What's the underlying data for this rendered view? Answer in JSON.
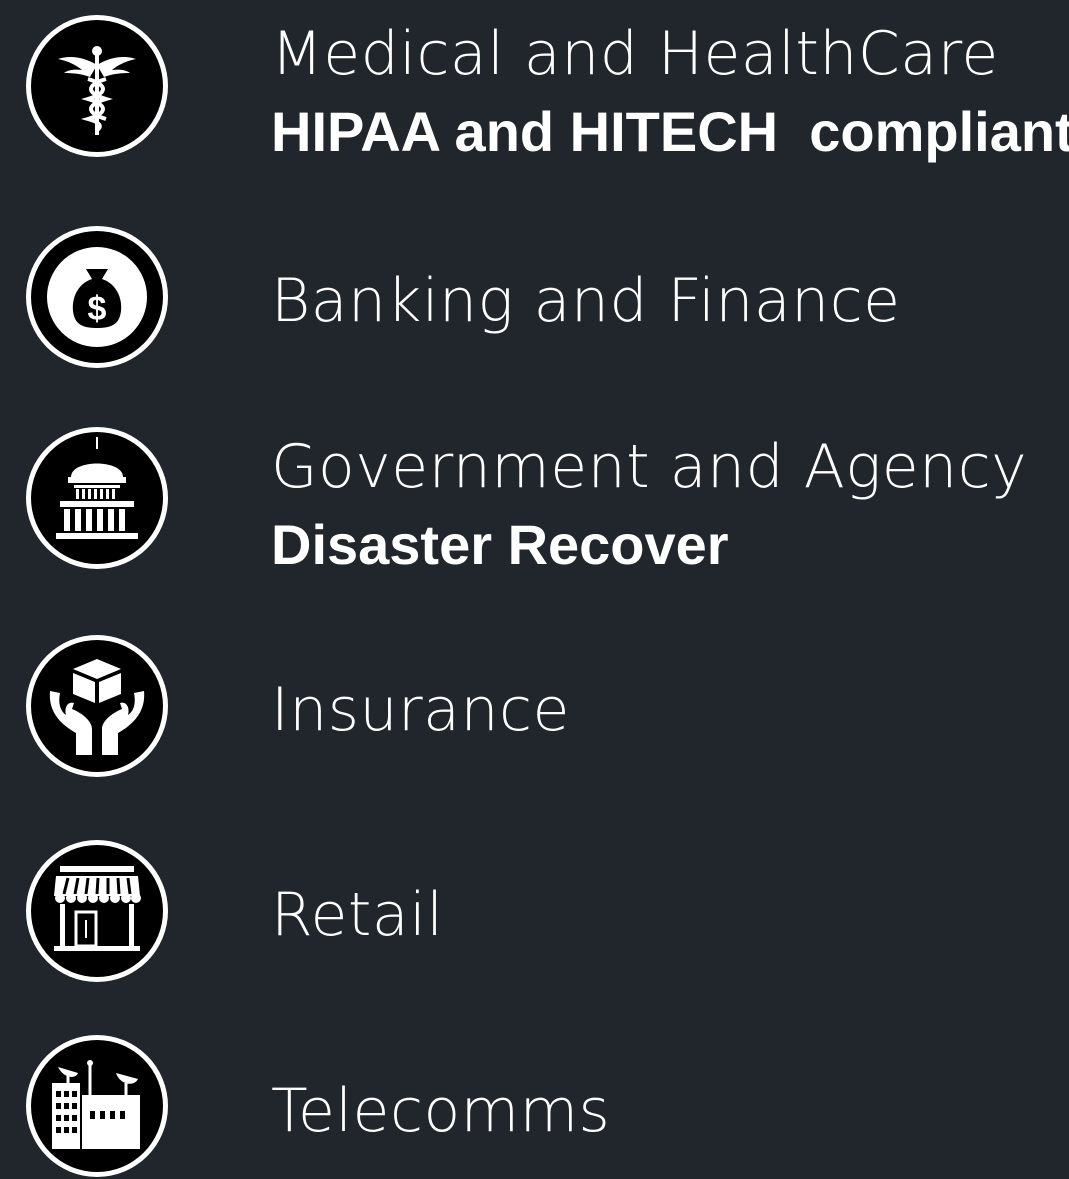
{
  "colors": {
    "background": "#21262c",
    "text": "#ffffff",
    "badge_fill": "#000000",
    "badge_ring": "#ffffff"
  },
  "industries": [
    {
      "icon": "caduceus-icon",
      "title": "Medical and HealthCare",
      "subtitle": "HIPAA and HITECH  compliant"
    },
    {
      "icon": "money-bag-icon",
      "title": "Banking and Finance",
      "subtitle": ""
    },
    {
      "icon": "capitol-building-icon",
      "title": "Government and Agency",
      "subtitle": "Disaster Recover"
    },
    {
      "icon": "hands-holding-box-icon",
      "title": "Insurance",
      "subtitle": ""
    },
    {
      "icon": "storefront-icon",
      "title": "Retail",
      "subtitle": ""
    },
    {
      "icon": "factory-antenna-icon",
      "title": "Telecomms",
      "subtitle": ""
    }
  ]
}
